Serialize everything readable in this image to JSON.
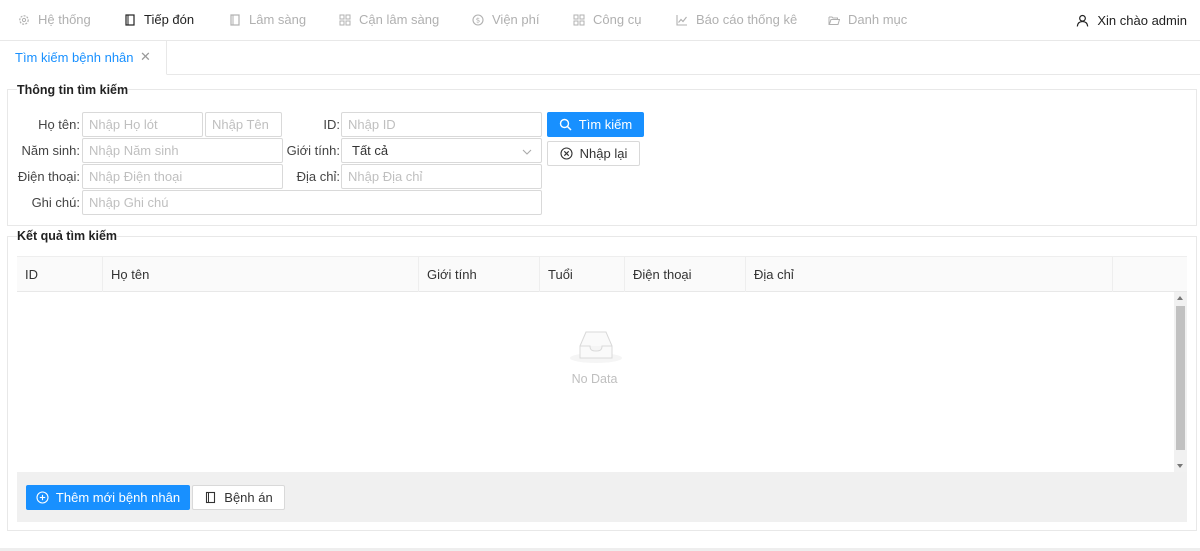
{
  "menu": {
    "items": [
      {
        "label": "Hệ thống",
        "icon": "gear-icon"
      },
      {
        "label": "Tiếp đón",
        "icon": "document-icon"
      },
      {
        "label": "Lâm sàng",
        "icon": "document-icon"
      },
      {
        "label": "Cận lâm sàng",
        "icon": "grid-icon"
      },
      {
        "label": "Viện phí",
        "icon": "dollar-circle-icon"
      },
      {
        "label": "Công cụ",
        "icon": "grid-icon"
      },
      {
        "label": "Báo cáo thống kê",
        "icon": "line-chart-icon"
      },
      {
        "label": "Danh mục",
        "icon": "folder-icon"
      }
    ],
    "active": "Tiếp đón",
    "greeting": "Xin chào admin",
    "user_icon": "user-icon"
  },
  "tabs": [
    {
      "label": "Tìm kiếm bệnh nhân",
      "close_icon": "close-icon"
    }
  ],
  "search": {
    "title": "Thông tin tìm kiếm",
    "fullname_label": "Họ tên",
    "middle_placeholder": "Nhập Họ lót",
    "first_placeholder": "Nhập Tên",
    "id_label": "ID",
    "id_placeholder": "Nhập ID",
    "birth_label": "Năm sinh",
    "birth_placeholder": "Nhập Năm sinh",
    "gender_label": "Giới tính",
    "gender_value": "Tất cả",
    "phone_label": "Điện thoại",
    "phone_placeholder": "Nhập Điện thoại",
    "address_label": "Địa chỉ",
    "address_placeholder": "Nhập Địa chỉ",
    "note_label": "Ghi chú",
    "note_placeholder": "Nhập Ghi chú",
    "search_button": "Tìm kiếm",
    "reset_button": "Nhập lại",
    "colon": ":"
  },
  "results": {
    "title": "Kết quả tìm kiếm",
    "columns": [
      "ID",
      "Họ tên",
      "Giới tính",
      "Tuổi",
      "Điện thoại",
      "Địa chỉ"
    ],
    "empty_text": "No Data",
    "add_button": "Thêm mới bệnh nhân",
    "record_button": "Bệnh án"
  },
  "colors": {
    "primary": "#1890ff",
    "muted": "#b0b0b0"
  }
}
